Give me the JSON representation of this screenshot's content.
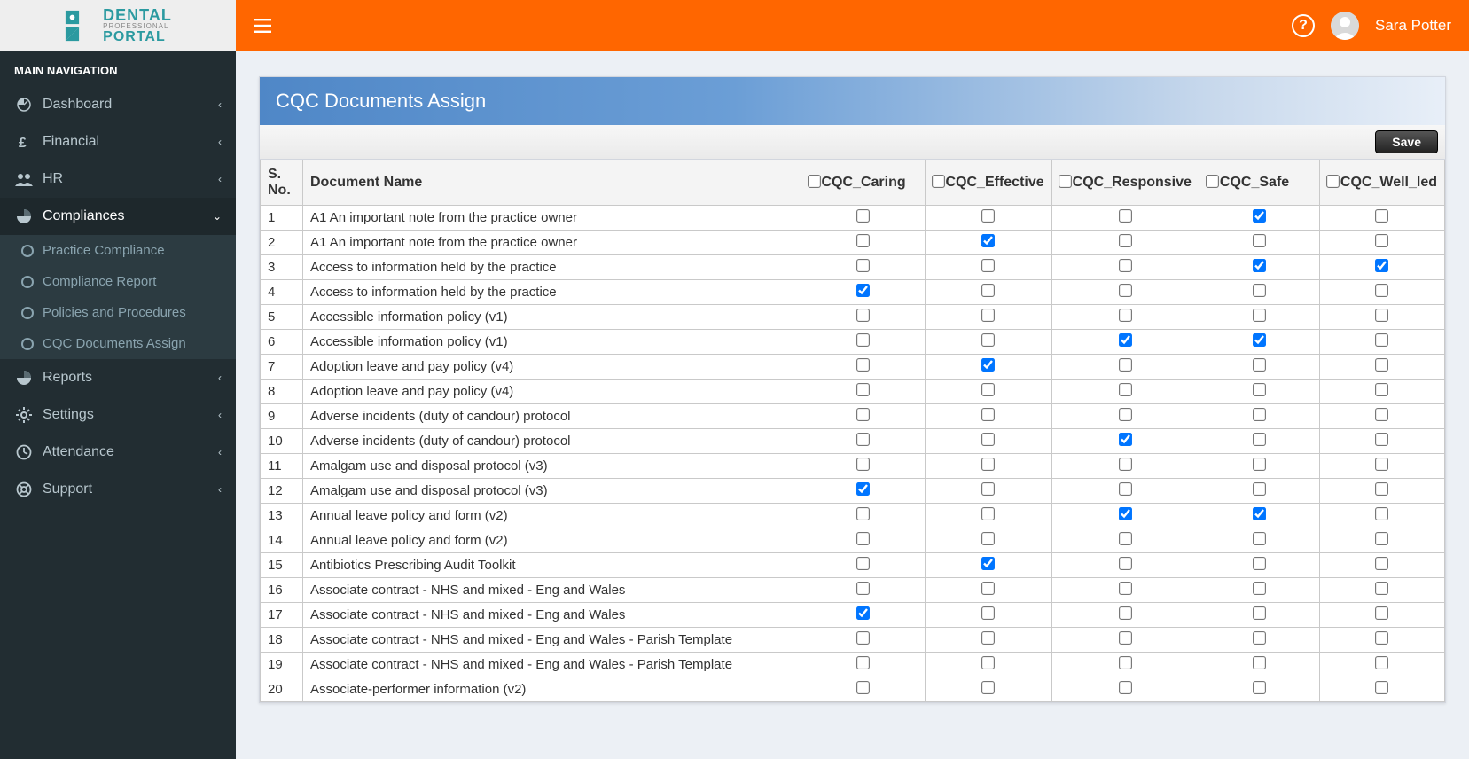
{
  "header": {
    "logo_top": "DENTAL",
    "logo_mid": "PROFESSIONAL",
    "logo_bot": "PORTAL",
    "username": "Sara Potter"
  },
  "sidebar": {
    "section_label": "MAIN NAVIGATION",
    "items": [
      {
        "icon": "dashboard",
        "label": "Dashboard",
        "expandable": true
      },
      {
        "icon": "pound",
        "label": "Financial",
        "expandable": true
      },
      {
        "icon": "people",
        "label": "HR",
        "expandable": true
      },
      {
        "icon": "pie",
        "label": "Compliances",
        "expandable": true,
        "active": true,
        "open": true,
        "children": [
          {
            "label": "Practice Compliance"
          },
          {
            "label": "Compliance Report"
          },
          {
            "label": "Policies and Procedures"
          },
          {
            "label": "CQC Documents Assign"
          }
        ]
      },
      {
        "icon": "pie",
        "label": "Reports",
        "expandable": true
      },
      {
        "icon": "gear",
        "label": "Settings",
        "expandable": true
      },
      {
        "icon": "clock",
        "label": "Attendance",
        "expandable": true
      },
      {
        "icon": "life-ring",
        "label": "Support",
        "expandable": true
      }
    ]
  },
  "panel": {
    "title": "CQC Documents Assign",
    "save_label": "Save",
    "columns": {
      "sno": "S. No.",
      "docname": "Document Name",
      "caring": "CQC_Caring",
      "effective": "CQC_Effective",
      "responsive": "CQC_Responsive",
      "safe": "CQC_Safe",
      "wellled": "CQC_Well_led"
    },
    "header_checks": {
      "caring": false,
      "effective": false,
      "responsive": false,
      "safe": false,
      "wellled": false
    },
    "rows": [
      {
        "n": 1,
        "name": "A1 An important note from the practice owner",
        "c": false,
        "e": false,
        "r": false,
        "s": true,
        "w": false
      },
      {
        "n": 2,
        "name": "A1 An important note from the practice owner",
        "c": false,
        "e": true,
        "r": false,
        "s": false,
        "w": false
      },
      {
        "n": 3,
        "name": "Access to information held by the practice",
        "c": false,
        "e": false,
        "r": false,
        "s": true,
        "w": true
      },
      {
        "n": 4,
        "name": "Access to information held by the practice",
        "c": true,
        "e": false,
        "r": false,
        "s": false,
        "w": false
      },
      {
        "n": 5,
        "name": "Accessible information policy (v1)",
        "c": false,
        "e": false,
        "r": false,
        "s": false,
        "w": false
      },
      {
        "n": 6,
        "name": "Accessible information policy (v1)",
        "c": false,
        "e": false,
        "r": true,
        "s": true,
        "w": false
      },
      {
        "n": 7,
        "name": "Adoption leave and pay policy (v4)",
        "c": false,
        "e": true,
        "r": false,
        "s": false,
        "w": false
      },
      {
        "n": 8,
        "name": "Adoption leave and pay policy (v4)",
        "c": false,
        "e": false,
        "r": false,
        "s": false,
        "w": false
      },
      {
        "n": 9,
        "name": "Adverse incidents (duty of candour) protocol",
        "c": false,
        "e": false,
        "r": false,
        "s": false,
        "w": false
      },
      {
        "n": 10,
        "name": "Adverse incidents (duty of candour) protocol",
        "c": false,
        "e": false,
        "r": true,
        "s": false,
        "w": false
      },
      {
        "n": 11,
        "name": "Amalgam use and disposal protocol (v3)",
        "c": false,
        "e": false,
        "r": false,
        "s": false,
        "w": false
      },
      {
        "n": 12,
        "name": "Amalgam use and disposal protocol (v3)",
        "c": true,
        "e": false,
        "r": false,
        "s": false,
        "w": false
      },
      {
        "n": 13,
        "name": "Annual leave policy and form (v2)",
        "c": false,
        "e": false,
        "r": true,
        "s": true,
        "w": false
      },
      {
        "n": 14,
        "name": "Annual leave policy and form (v2)",
        "c": false,
        "e": false,
        "r": false,
        "s": false,
        "w": false
      },
      {
        "n": 15,
        "name": "Antibiotics Prescribing Audit Toolkit",
        "c": false,
        "e": true,
        "r": false,
        "s": false,
        "w": false
      },
      {
        "n": 16,
        "name": "Associate contract - NHS and mixed - Eng and Wales",
        "c": false,
        "e": false,
        "r": false,
        "s": false,
        "w": false
      },
      {
        "n": 17,
        "name": "Associate contract - NHS and mixed - Eng and Wales",
        "c": true,
        "e": false,
        "r": false,
        "s": false,
        "w": false
      },
      {
        "n": 18,
        "name": "Associate contract - NHS and mixed - Eng and Wales - Parish Template",
        "c": false,
        "e": false,
        "r": false,
        "s": false,
        "w": false
      },
      {
        "n": 19,
        "name": "Associate contract - NHS and mixed - Eng and Wales - Parish Template",
        "c": false,
        "e": false,
        "r": false,
        "s": false,
        "w": false
      },
      {
        "n": 20,
        "name": "Associate-performer information (v2)",
        "c": false,
        "e": false,
        "r": false,
        "s": false,
        "w": false
      }
    ]
  }
}
